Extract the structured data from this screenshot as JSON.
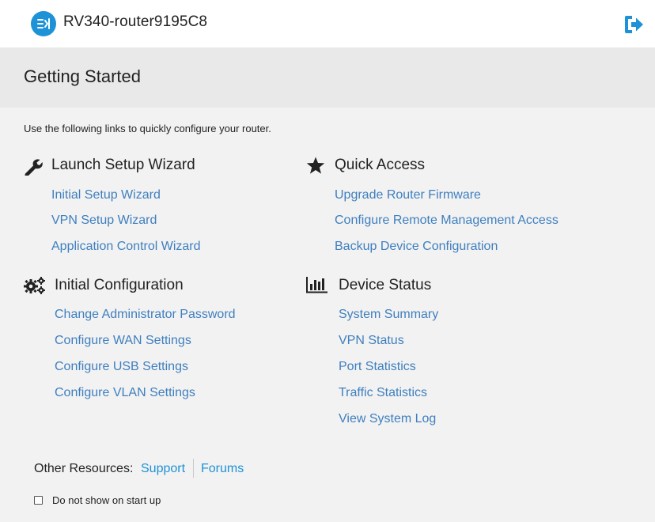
{
  "header": {
    "device_name": "RV340-router9195C8",
    "brand_icon": "menu-collapse-icon",
    "logout_icon": "logout-icon",
    "accent_color": "#1d92d6"
  },
  "page": {
    "title": "Getting Started",
    "intro": "Use the following links to quickly configure your router."
  },
  "sections": {
    "setup_wizard": {
      "title": "Launch Setup Wizard",
      "icon": "wrench-icon",
      "links": [
        "Initial Setup Wizard",
        "VPN Setup Wizard",
        "Application Control Wizard"
      ]
    },
    "quick_access": {
      "title": "Quick Access",
      "icon": "star-icon",
      "links": [
        "Upgrade Router Firmware",
        "Configure Remote Management Access",
        "Backup Device Configuration"
      ]
    },
    "initial_config": {
      "title": "Initial Configuration",
      "icon": "gears-icon",
      "links": [
        "Change Administrator Password",
        "Configure WAN Settings",
        "Configure USB Settings",
        "Configure VLAN Settings"
      ]
    },
    "device_status": {
      "title": "Device Status",
      "icon": "bar-chart-icon",
      "links": [
        "System Summary",
        "VPN Status",
        "Port Statistics",
        "Traffic Statistics",
        "View System Log"
      ]
    }
  },
  "footer": {
    "resources_label": "Other Resources:",
    "support": "Support",
    "forums": "Forums",
    "checkbox_label": "Do not show on start up",
    "checkbox_checked": false
  },
  "colors": {
    "link": "#3f7fbf",
    "resource_link": "#1d92d6",
    "background": "#f2f2f2",
    "title_band": "#e9e9e9"
  }
}
